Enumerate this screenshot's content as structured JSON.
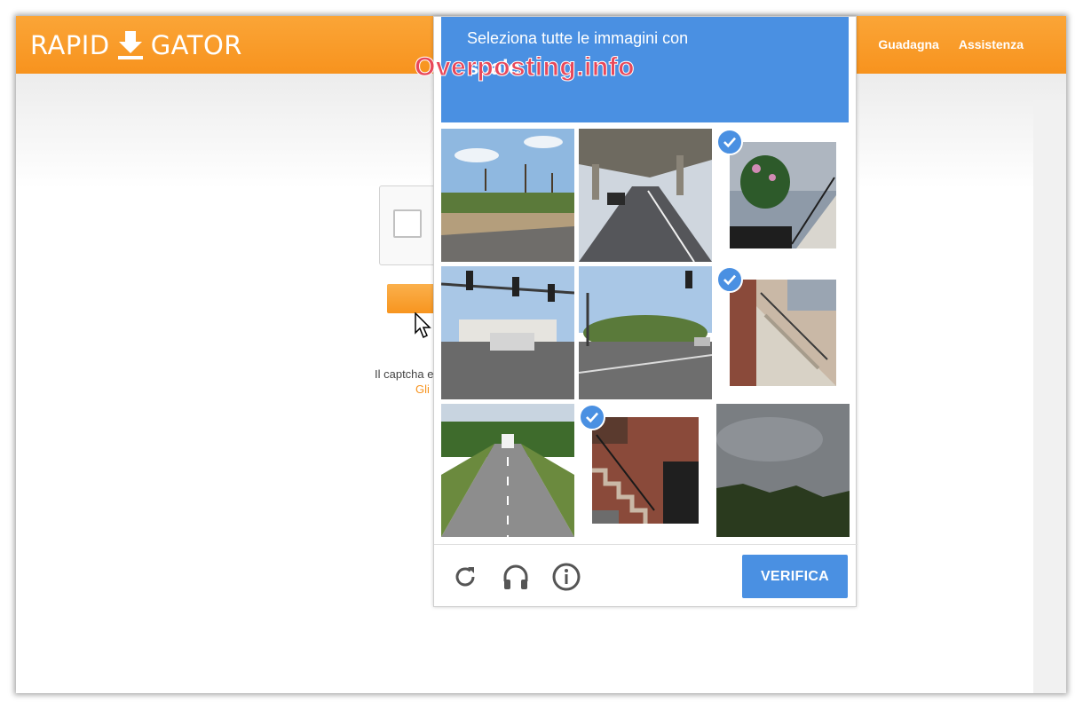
{
  "site": {
    "logo_left": "RAPID",
    "logo_right": "GATOR",
    "nav": [
      "Guadagna",
      "Assistenza"
    ],
    "captcha_text": "Il captcha e",
    "captcha_link": "Gli"
  },
  "popup": {
    "prompt": "Seleziona tutte le immagini con",
    "keyword": "scale",
    "watermark": "Overposting.info",
    "verify_label": "VERIFICA",
    "icons": [
      "reload-icon",
      "headphones-icon",
      "info-icon"
    ],
    "accent_color": "#4a90e2",
    "tiles": [
      {
        "scene": "palm-trees-parking",
        "selected": false
      },
      {
        "scene": "highway-overpass",
        "selected": false
      },
      {
        "scene": "house-stairs-flowers",
        "selected": true
      },
      {
        "scene": "intersection-traffic-lights",
        "selected": false
      },
      {
        "scene": "intersection-traffic-lights-2",
        "selected": false
      },
      {
        "scene": "concrete-stairs",
        "selected": true
      },
      {
        "scene": "highway-truck",
        "selected": false
      },
      {
        "scene": "brick-stairs",
        "selected": true
      },
      {
        "scene": "cloudy-sky-trees",
        "selected": false
      }
    ]
  }
}
